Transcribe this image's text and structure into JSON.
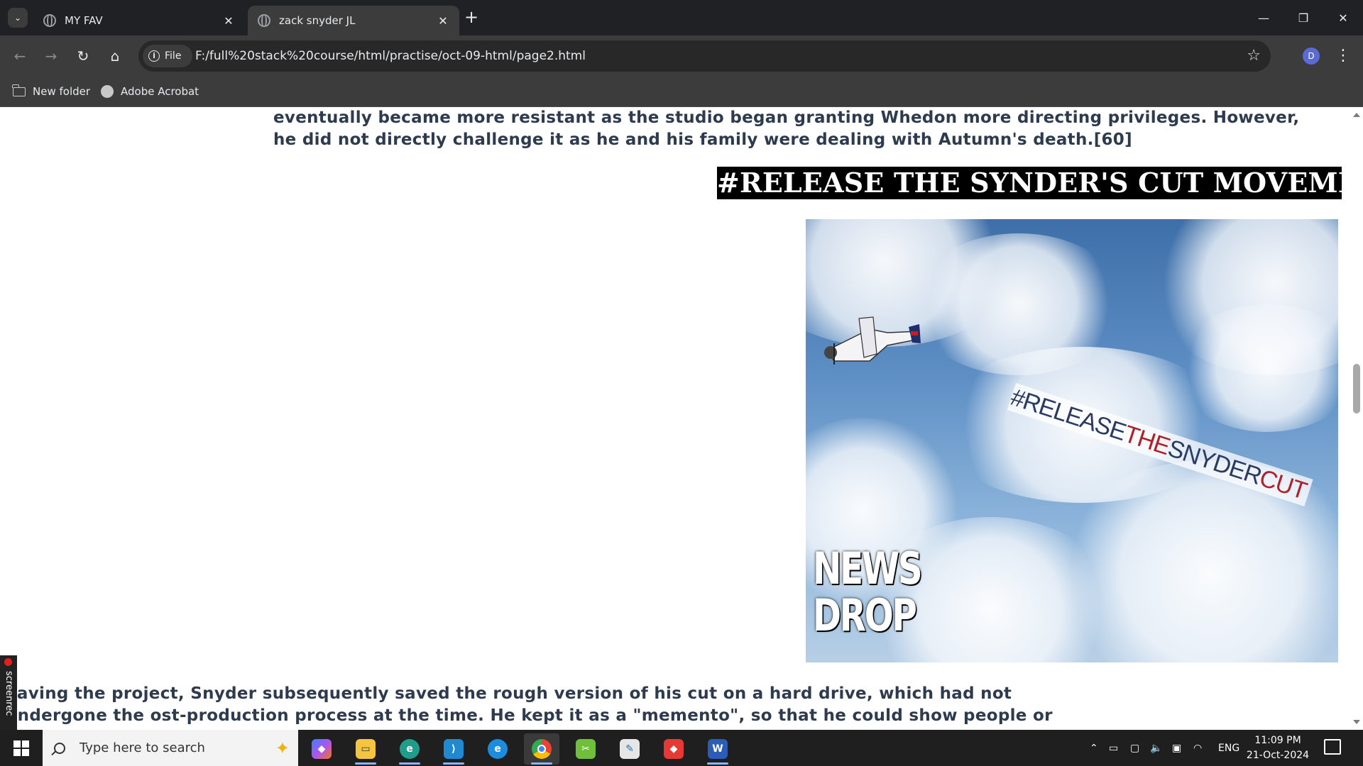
{
  "browser": {
    "tabs": [
      {
        "title": "MY FAV"
      },
      {
        "title": "zack snyder JL"
      }
    ],
    "new_tab_label": "+",
    "omnibox": {
      "chip_label": "File",
      "url": "F:/full%20stack%20course/html/practise/oct-09-html/page2.html"
    },
    "profile_initial": "D",
    "bookmarks": [
      {
        "label": "New folder",
        "icon": "folder-icon"
      },
      {
        "label": "Adobe Acrobat",
        "icon": "acrobat-icon"
      }
    ]
  },
  "page": {
    "para1": "eventually became more resistant as the studio began granting Whedon more directing privileges. However, he did not directly challenge it as he and his family were dealing with Autumn's death.[60]",
    "heading": "#RELEASE THE SYNDER'S CUT MOVEMENT",
    "image": {
      "banner_part1": "#RELEASE",
      "banner_part2": "THE",
      "banner_part3": "SNYDER",
      "banner_part4": "CUT",
      "logo_line1": "NEWS",
      "logo_line2": "DROP"
    },
    "para2": "eaving the project, Snyder subsequently saved the rough version of his cut on a hard drive, which had not undergone the ost-production process at the time. He kept it as a \"memento\", so that he could show people or for \"snippets\" of footage to"
  },
  "overlay": {
    "screenrec_label": "screenrec"
  },
  "taskbar": {
    "search_placeholder": "Type here to search",
    "apps": [
      "copilot-icon",
      "file-explorer-icon",
      "edge-dev-icon",
      "vscode-icon",
      "edge-icon",
      "chrome-icon",
      "snipping-tool-icon",
      "notepad-icon",
      "anydesk-icon",
      "word-icon"
    ],
    "language": "ENG",
    "time": "11:09 PM",
    "date": "21-Oct-2024"
  }
}
